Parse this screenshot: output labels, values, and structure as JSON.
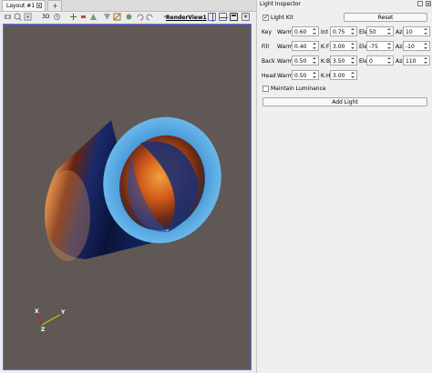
{
  "tabs": {
    "layout": "Layout #1",
    "add": "+"
  },
  "render_view": {
    "label": "RenderView1"
  },
  "toolbar": {
    "three_d": "3D"
  },
  "axes": {
    "x": "X",
    "y": "Y",
    "z": "Z"
  },
  "panel": {
    "title": "Light Inspector",
    "light_kit": "Light Kit",
    "reset": "Reset",
    "rows": [
      {
        "name": "Key",
        "c1": "Warm",
        "v1": "0.60",
        "c2": "Int",
        "v2": "0.75",
        "c3": "Ele",
        "v3": "50",
        "c4": "Azi",
        "v4": "10"
      },
      {
        "name": "Fill",
        "c1": "Warm",
        "v1": "0.40",
        "c2": "K:F",
        "v2": "3.00",
        "c3": "Ele",
        "v3": "-75",
        "c4": "Azi",
        "v4": "-10"
      },
      {
        "name": "Back",
        "c1": "Warm",
        "v1": "0.50",
        "c2": "K:B",
        "v2": "3.50",
        "c3": "Ele",
        "v3": "0",
        "c4": "Azi",
        "v4": "110"
      },
      {
        "name": "Head",
        "c1": "Warm",
        "v1": "0.50",
        "c2": "K:H",
        "v2": "3.00"
      }
    ],
    "maintain_luminance": "Maintain Luminance",
    "add_light": "Add Light"
  }
}
